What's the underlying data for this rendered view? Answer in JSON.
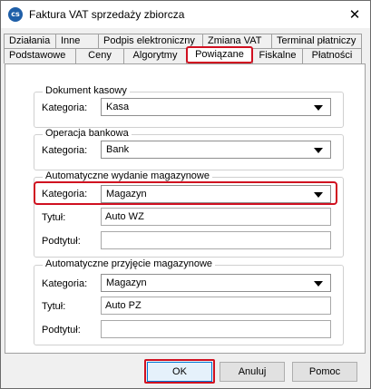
{
  "window": {
    "title": "Faktura VAT sprzedaży zbiorcza",
    "icon": "app-logo-icon",
    "close_label": "✕"
  },
  "tabs": {
    "back_row": [
      "Działania",
      "Inne",
      "Podpis elektroniczny",
      "Zmiana VAT",
      "Terminal płatniczy"
    ],
    "front_row": [
      "Podstawowe",
      "Ceny",
      "Algorytmy",
      "Powiązane",
      "Fiskalne",
      "Płatności"
    ],
    "active": "Powiązane"
  },
  "groups": {
    "cash": {
      "title": "Dokument kasowy",
      "category_label": "Kategoria:",
      "category_value": "Kasa"
    },
    "bank": {
      "title": "Operacja bankowa",
      "category_label": "Kategoria:",
      "category_value": "Bank"
    },
    "issue": {
      "title": "Automatyczne wydanie magazynowe",
      "category_label": "Kategoria:",
      "category_value": "Magazyn",
      "title_label": "Tytuł:",
      "title_value": "Auto WZ",
      "subtitle_label": "Podtytuł:",
      "subtitle_value": ""
    },
    "receipt": {
      "title": "Automatyczne przyjęcie magazynowe",
      "category_label": "Kategoria:",
      "category_value": "Magazyn",
      "title_label": "Tytuł:",
      "title_value": "Auto PZ",
      "subtitle_label": "Podtytuł:",
      "subtitle_value": ""
    }
  },
  "buttons": {
    "ok": "OK",
    "cancel": "Anuluj",
    "help": "Pomoc"
  },
  "colors": {
    "highlight": "#d01020",
    "panel_bg": "#ffffff",
    "window_bg": "#f0f0f0"
  }
}
